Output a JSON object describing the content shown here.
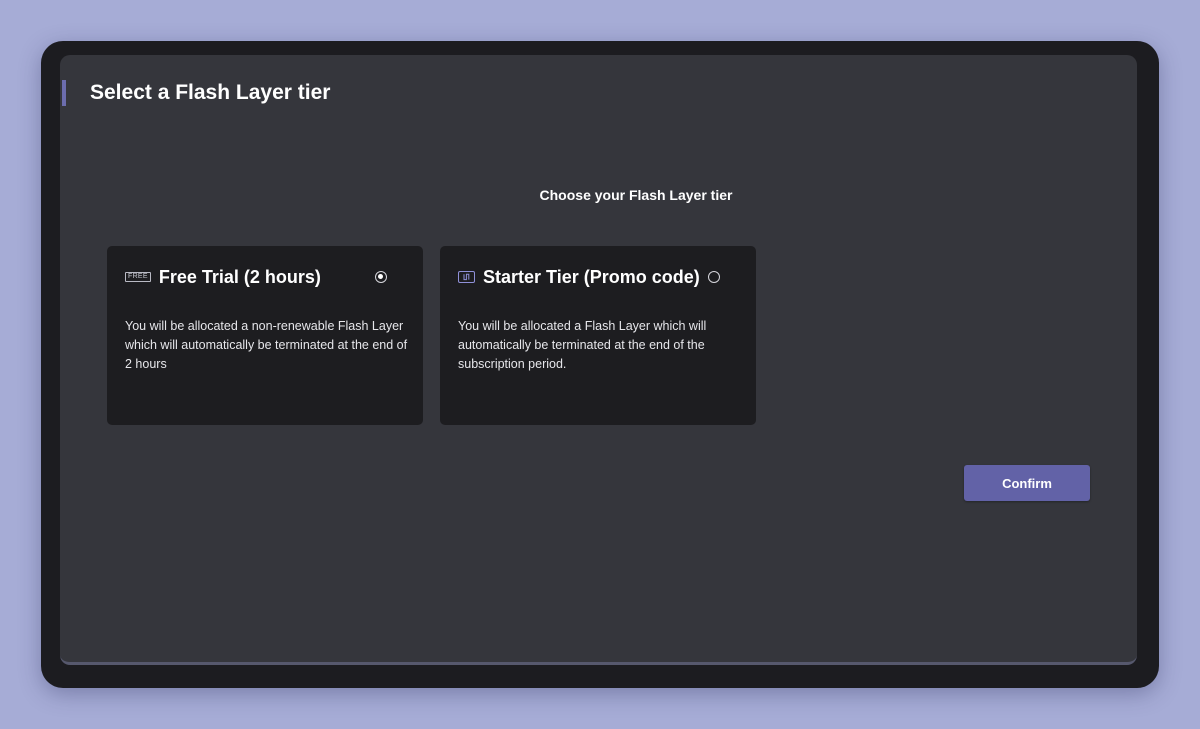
{
  "header": {
    "title": "Select a Flash Layer tier"
  },
  "main": {
    "subtitle": "Choose your Flash Layer tier",
    "tiers": [
      {
        "badge": "FREE",
        "title": "Free Trial (2 hours)",
        "description": "You will be allocated a non-renewable Flash Layer which will automatically be terminated at the end of 2 hours",
        "selected": true
      },
      {
        "icon": "starter-tier-icon",
        "title": "Starter Tier (Promo code)",
        "description": "You will be allocated a Flash Layer which will automatically be terminated at the end of the subscription period.",
        "selected": false
      }
    ],
    "confirm_label": "Confirm"
  },
  "colors": {
    "background": "#a6acd6",
    "panel": "#35363c",
    "card": "#1d1d20",
    "accent": "#6262a7"
  }
}
